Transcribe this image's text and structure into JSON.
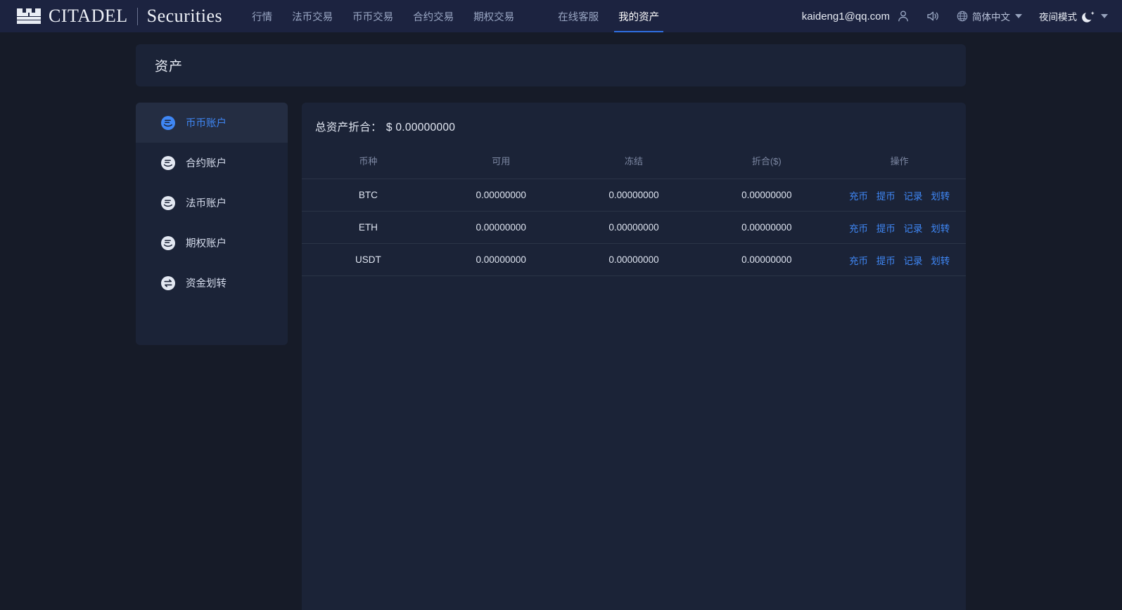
{
  "header": {
    "brand_main": "CITADEL",
    "brand_sub": "Securities",
    "nav": [
      {
        "label": "行情",
        "active": false
      },
      {
        "label": "法币交易",
        "active": false
      },
      {
        "label": "币币交易",
        "active": false
      },
      {
        "label": "合约交易",
        "active": false
      },
      {
        "label": "期权交易",
        "active": false
      },
      {
        "label": "在线客服",
        "active": false
      },
      {
        "label": "我的资产",
        "active": true
      }
    ],
    "user_email": "kaideng1@qq.com",
    "language": "简体中文",
    "theme_mode": "夜间模式"
  },
  "page": {
    "title": "资产"
  },
  "sidebar": {
    "items": [
      {
        "label": "币币账户",
        "icon": "coin-icon",
        "active": true
      },
      {
        "label": "合约账户",
        "icon": "coin-icon",
        "active": false
      },
      {
        "label": "法币账户",
        "icon": "coin-icon",
        "active": false
      },
      {
        "label": "期权账户",
        "icon": "coin-icon",
        "active": false
      },
      {
        "label": "资金划转",
        "icon": "transfer-icon",
        "active": false
      }
    ]
  },
  "assets": {
    "total_label": "总资产折合：",
    "total_value": "$ 0.00000000",
    "columns": [
      "币种",
      "可用",
      "冻结",
      "折合($)",
      "操作"
    ],
    "actions": [
      "充币",
      "提币",
      "记录",
      "划转"
    ],
    "rows": [
      {
        "coin": "BTC",
        "available": "0.00000000",
        "frozen": "0.00000000",
        "valuation": "0.00000000"
      },
      {
        "coin": "ETH",
        "available": "0.00000000",
        "frozen": "0.00000000",
        "valuation": "0.00000000"
      },
      {
        "coin": "USDT",
        "available": "0.00000000",
        "frozen": "0.00000000",
        "valuation": "0.00000000"
      }
    ]
  },
  "colors": {
    "accent_blue": "#3f87f5",
    "header_bg": "#1c2340",
    "panel_bg": "#1b2337",
    "page_bg": "#161b28"
  }
}
